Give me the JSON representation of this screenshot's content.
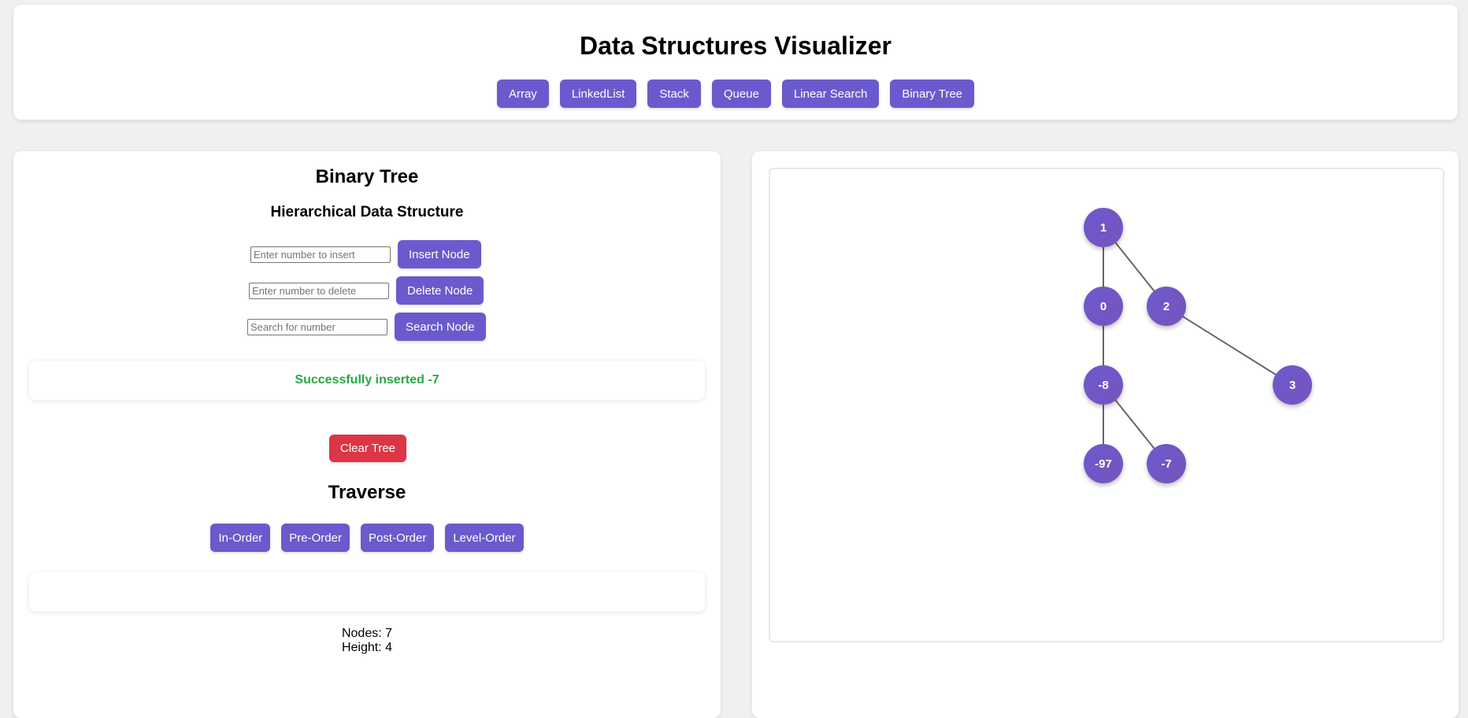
{
  "header": {
    "title": "Data Structures Visualizer",
    "nav": [
      "Array",
      "LinkedList",
      "Stack",
      "Queue",
      "Linear Search",
      "Binary Tree"
    ]
  },
  "panel": {
    "title": "Binary Tree",
    "subtitle": "Hierarchical Data Structure",
    "insert": {
      "placeholder": "Enter number to insert",
      "button": "Insert Node"
    },
    "delete": {
      "placeholder": "Enter number to delete",
      "button": "Delete Node"
    },
    "search": {
      "placeholder": "Search for number",
      "button": "Search Node"
    },
    "message": "Successfully inserted -7",
    "clear_button": "Clear Tree",
    "traverse_title": "Traverse",
    "traversals": [
      "In-Order",
      "Pre-Order",
      "Post-Order",
      "Level-Order"
    ],
    "traversal_output": "",
    "stats": {
      "nodes": "Nodes: 7",
      "height": "Height: 4"
    }
  },
  "tree": {
    "nodes": [
      "1",
      "0",
      "2",
      "-8",
      "3",
      "-97",
      "-7"
    ],
    "edges": [
      [
        "1",
        "0"
      ],
      [
        "1",
        "2"
      ],
      [
        "0",
        "-8"
      ],
      [
        "2",
        "3"
      ],
      [
        "-8",
        "-97"
      ],
      [
        "-8",
        "-7"
      ]
    ]
  },
  "colors": {
    "accent": "#6a5acd",
    "danger": "#dc3545",
    "success": "#28a745"
  }
}
